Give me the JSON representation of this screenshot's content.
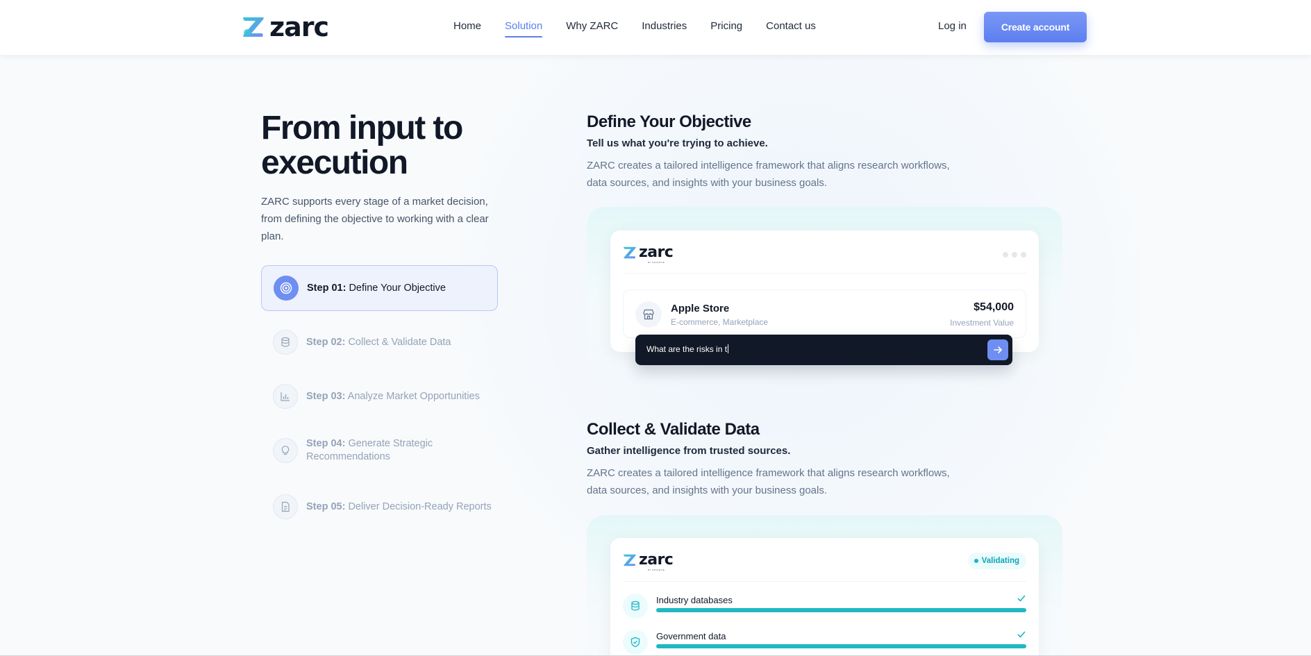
{
  "header": {
    "brand": "zarc",
    "nav": [
      {
        "label": "Home",
        "active": false
      },
      {
        "label": "Solution",
        "active": true
      },
      {
        "label": "Why ZARC",
        "active": false
      },
      {
        "label": "Industries",
        "active": false
      },
      {
        "label": "Pricing",
        "active": false
      },
      {
        "label": "Contact us",
        "active": false
      }
    ],
    "login_label": "Log in",
    "cta_label": "Create account"
  },
  "hero": {
    "title": "From input to execution",
    "description": "ZARC supports every stage of a market decision, from defining the objective to working with a clear plan."
  },
  "steps": [
    {
      "number": "Step 01:",
      "label": "Define Your Objective",
      "icon": "target-icon",
      "active": true
    },
    {
      "number": "Step 02:",
      "label": "Collect & Validate Data",
      "icon": "database-icon",
      "active": false
    },
    {
      "number": "Step 03:",
      "label": "Analyze Market Opportunities",
      "icon": "bar-chart-icon",
      "active": false
    },
    {
      "number": "Step 04:",
      "label": "Generate Strategic Recommendations",
      "icon": "lightbulb-icon",
      "active": false
    },
    {
      "number": "Step 05:",
      "label": "Deliver Decision-Ready Reports",
      "icon": "document-icon",
      "active": false
    }
  ],
  "sections": [
    {
      "title": "Define Your Objective",
      "subtitle": "Tell us what you're trying to achieve.",
      "description": "ZARC creates a tailored intelligence framework that aligns research workflows, data sources, and insights with your business goals.",
      "card": {
        "brand": "zarc",
        "byline": "BY SOCIETIE",
        "item": {
          "name": "Apple Store",
          "category": "E-commerce, Marketplace",
          "value": "$54,000",
          "value_label": "Investment Value"
        },
        "prompt_text": "What are the risks in t"
      }
    },
    {
      "title": "Collect & Validate Data",
      "subtitle": "Gather intelligence from trusted sources.",
      "description": "ZARC creates a tailored intelligence framework that aligns research workflows, data sources, and insights with your business goals.",
      "card": {
        "brand": "zarc",
        "byline": "BY SOCIETIE",
        "status": "Validating",
        "sources": [
          {
            "label": "Industry databases",
            "icon": "database-icon",
            "progress": 1.0,
            "done": true
          },
          {
            "label": "Government data",
            "icon": "shield-icon",
            "progress": 1.0,
            "done": true
          }
        ]
      }
    }
  ],
  "colors": {
    "accent": "#5b7df0",
    "teal": "#1fb8c3",
    "dark": "#111827"
  }
}
